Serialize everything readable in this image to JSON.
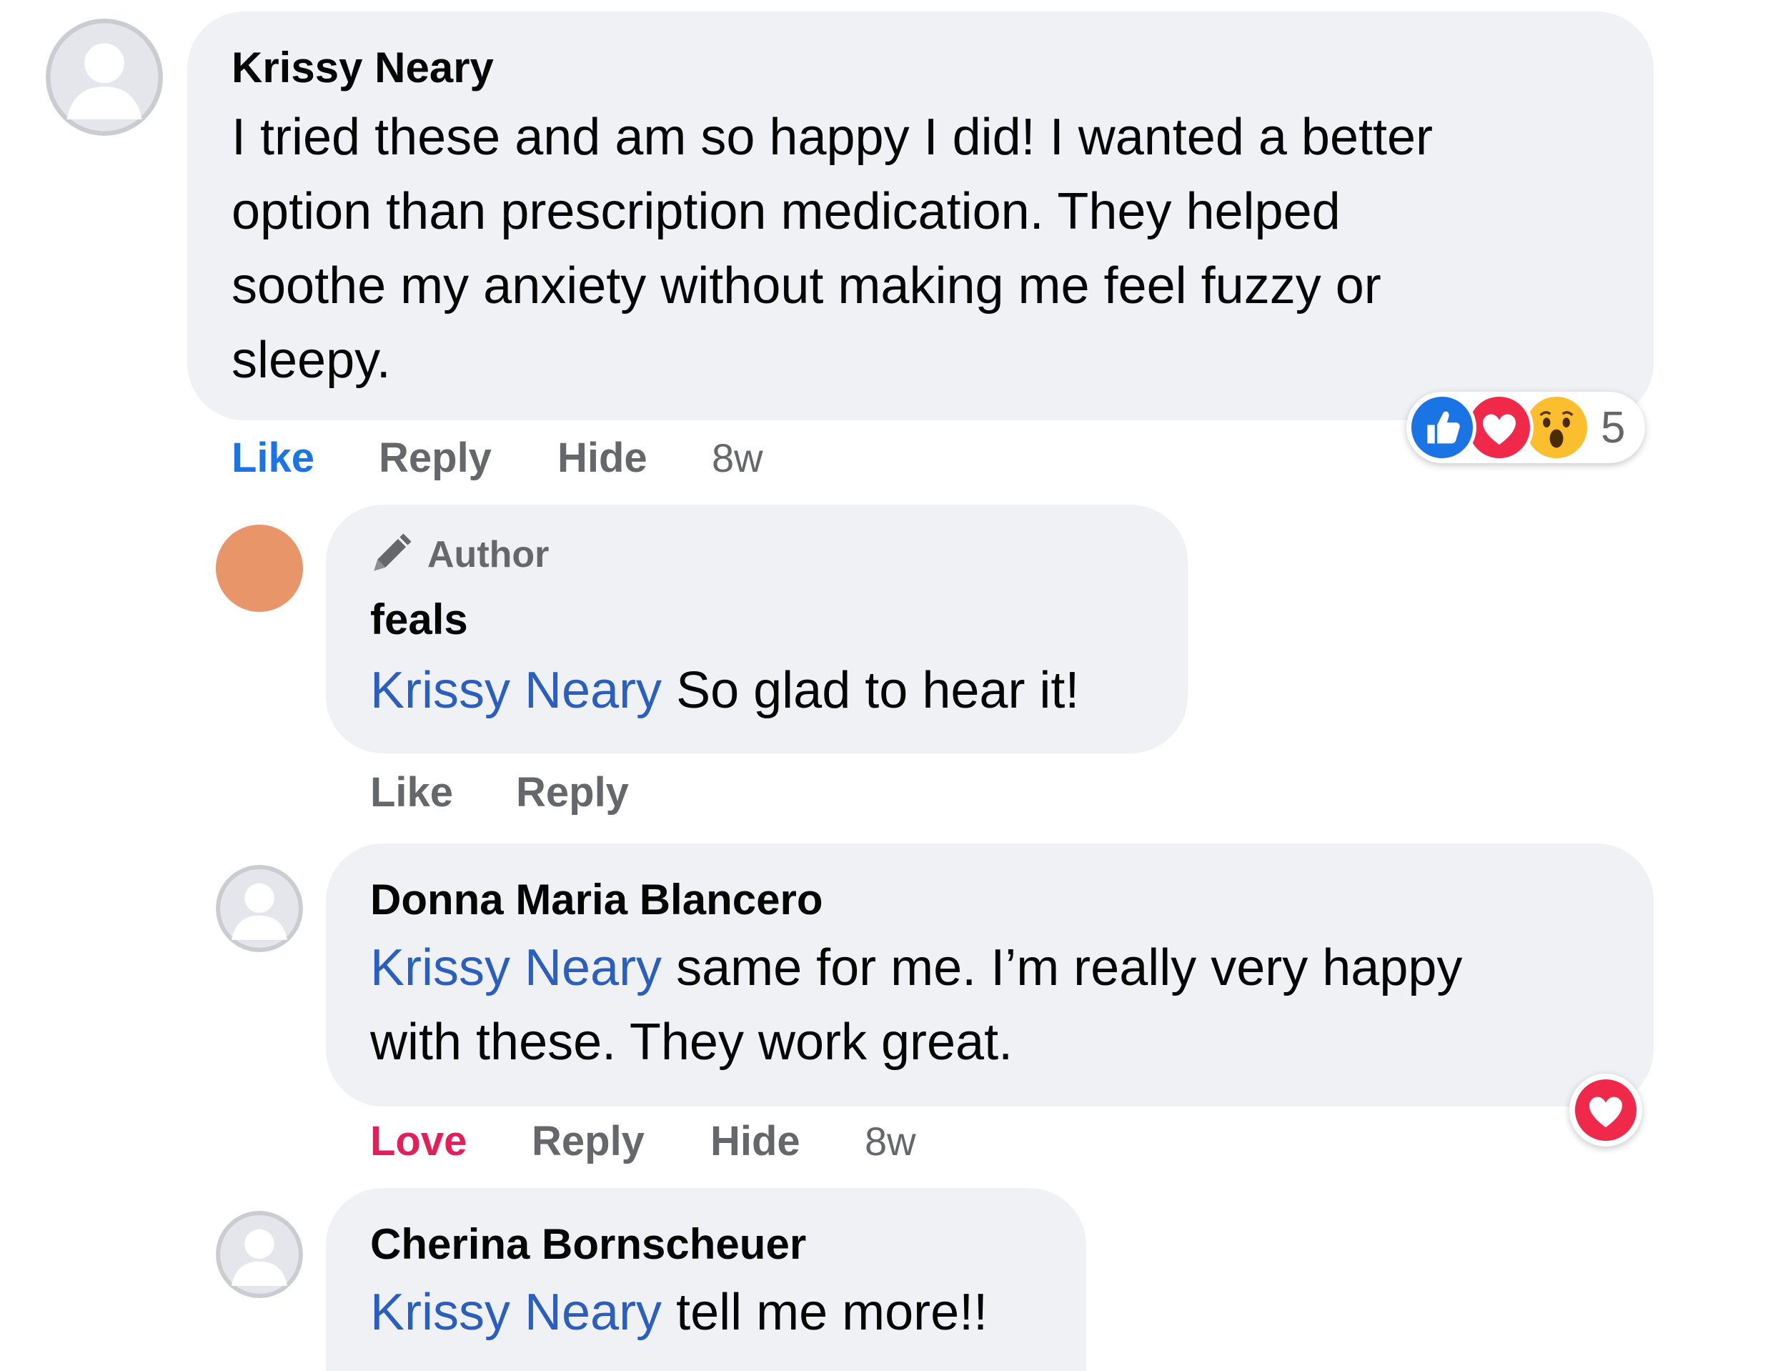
{
  "comments": [
    {
      "author": "Krissy Neary",
      "text_lines": [
        "I tried these and am so happy I did! I wanted a better",
        "option than prescription medication. They helped",
        "soothe my anxiety without making me feel fuzzy or",
        "sleepy."
      ],
      "actions": {
        "like": "Like",
        "reply": "Reply",
        "hide": "Hide"
      },
      "time": "8w",
      "reactions": {
        "icons": [
          "like-icon",
          "love-icon",
          "wow-icon"
        ],
        "count": "5"
      }
    },
    {
      "badge": "Author",
      "author": "feals",
      "mention": "Krissy Neary",
      "text": " So glad to hear it!",
      "actions": {
        "like": "Like",
        "reply": "Reply"
      }
    },
    {
      "author": "Donna Maria Blancero",
      "mention": "Krissy Neary",
      "text_line1": " same for me. I’m really very happy",
      "text_line2": "with these. They work great.",
      "actions": {
        "love": "Love",
        "reply": "Reply",
        "hide": "Hide"
      },
      "time": "8w",
      "reactions": {
        "icons": [
          "love-icon"
        ]
      }
    },
    {
      "author": "Cherina Bornscheuer",
      "mention": "Krissy Neary",
      "text": " tell me more!!"
    }
  ],
  "colors": {
    "bubble": "#eff1f4",
    "mention": "#2a5fbf",
    "like_active": "#1b74e4",
    "love_active": "#e41e5a",
    "secondary_text": "#65676b",
    "author_avatar": "#e8956a"
  }
}
